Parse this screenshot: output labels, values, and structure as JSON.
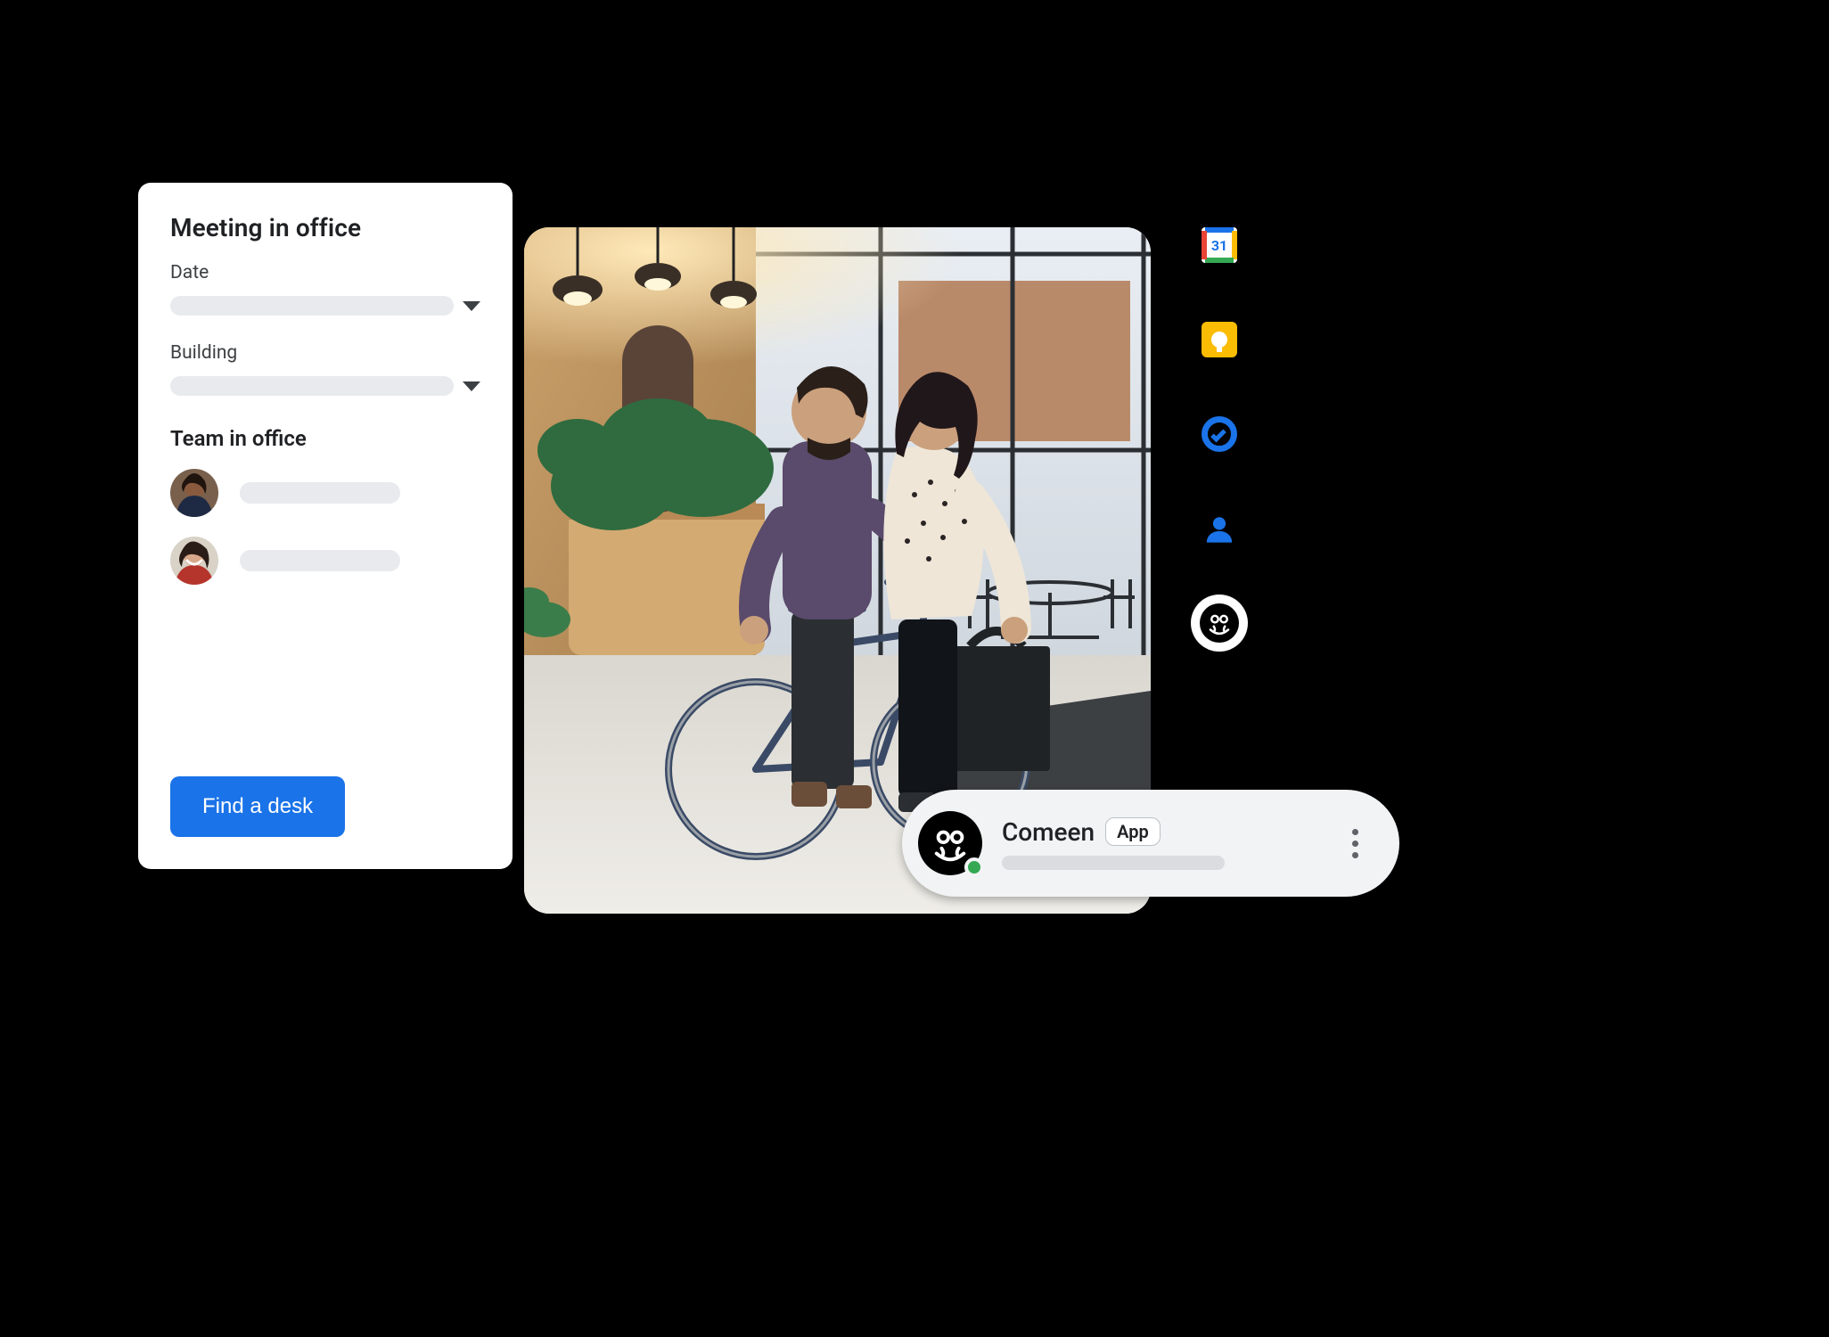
{
  "meeting_card": {
    "title": "Meeting in office",
    "date_label": "Date",
    "building_label": "Building",
    "team_section_title": "Team in office",
    "cta_label": "Find a desk"
  },
  "rail": {
    "calendar_day": "31"
  },
  "space_pill": {
    "name": "Comeen",
    "badge": "App"
  }
}
